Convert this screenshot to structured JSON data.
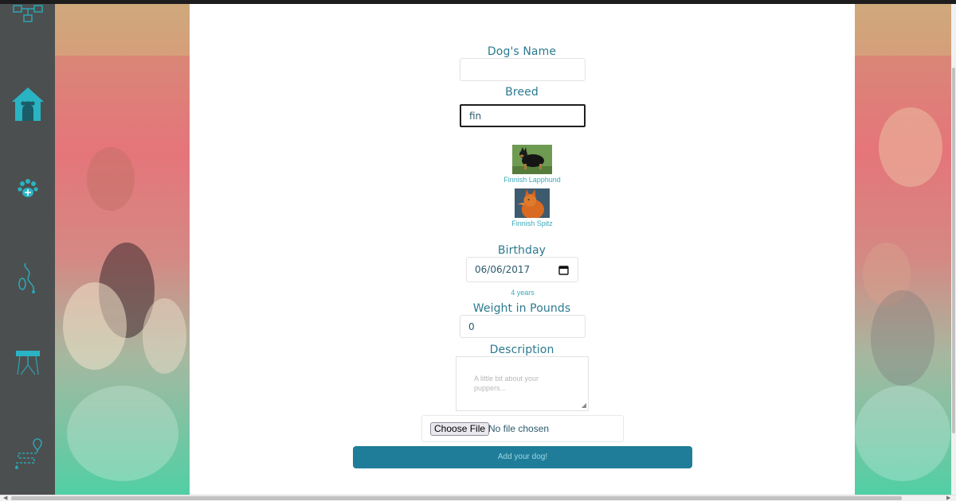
{
  "nav": {
    "items": [
      {
        "label": "",
        "icon": "network-icon"
      },
      {
        "label": "",
        "icon": "dog-house-icon"
      },
      {
        "label": "",
        "icon": "paw-icon"
      },
      {
        "label": "",
        "icon": "leash-icon"
      },
      {
        "label": "",
        "icon": "table-icon"
      },
      {
        "label": "",
        "icon": "route-icon"
      }
    ]
  },
  "form": {
    "name_label": "Dog's Name",
    "name_value": "",
    "breed_label": "Breed",
    "breed_value": "fin",
    "suggestions": [
      {
        "name": "Finnish Lapphund"
      },
      {
        "name": "Finnish Spitz"
      }
    ],
    "birthday_label": "Birthday",
    "birthday_value": "06/06/2017",
    "age_text": "4 years",
    "weight_label": "Weight in Pounds",
    "weight_value": "0",
    "description_label": "Description",
    "description_placeholder": "A little bit about your puppers...",
    "file_button": "Choose File",
    "file_status": "No file chosen",
    "submit_label": "Add your dog!"
  },
  "colors": {
    "accent": "#1f7d99",
    "label_text": "#2b7a8f",
    "nav_bg": "#4c4f4f",
    "nav_icon": "#2aa5b4"
  }
}
